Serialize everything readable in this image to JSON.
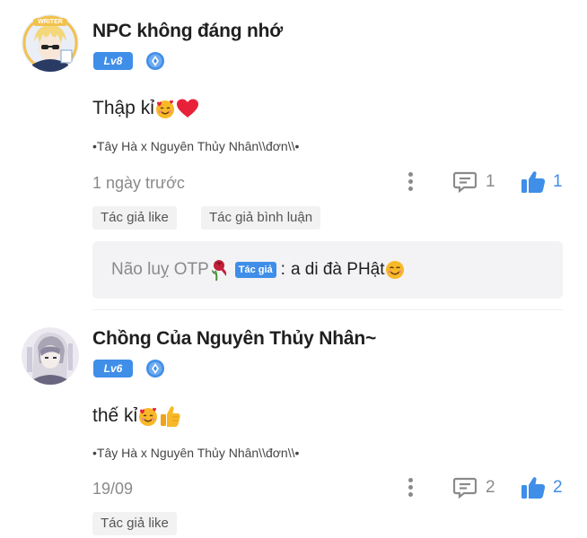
{
  "comments": [
    {
      "username": "NPC không đáng nhớ",
      "level": "Lv8",
      "text": "Thập kỉ",
      "topic": "•Tây Hà x Nguyên Thủy Nhân\\\\đơn\\\\•",
      "time": "1 ngày trước",
      "reply_count": "1",
      "like_count": "1",
      "tags": [
        "Tác giả like",
        "Tác giả bình luận"
      ],
      "reply": {
        "user": "Não luỵ OTP",
        "author_badge": "Tác giả",
        "separator": ":",
        "text": "a di đà PHật"
      },
      "avatar_badge": "WRITER"
    },
    {
      "username": "Chồng Của Nguyên Thủy Nhân~",
      "level": "Lv6",
      "text": "thế kỉ",
      "topic": "•Tây Hà x Nguyên Thủy Nhân\\\\đơn\\\\•",
      "time": "19/09",
      "reply_count": "2",
      "like_count": "2",
      "tags": [
        "Tác giả like"
      ]
    }
  ],
  "colors": {
    "accent": "#3f8ee8",
    "muted_text": "#8a8a8a",
    "tag_bg": "#f2f2f2",
    "reply_bg": "#f3f3f5",
    "heart": "#e8213a",
    "emoji_yellow": "#f7b928"
  },
  "icons": {
    "rank": "diamond-rank-icon",
    "more": "more-vertical-icon",
    "reply": "comment-bubble-icon",
    "like": "thumbs-up-icon",
    "emoji_1": "smiling-face-with-hearts-icon",
    "emoji_2": "red-heart-icon",
    "emoji_3": "thumbs-up-emoji-icon",
    "emoji_4": "smiling-face-icon",
    "emoji_5": "wilted-rose-icon"
  }
}
